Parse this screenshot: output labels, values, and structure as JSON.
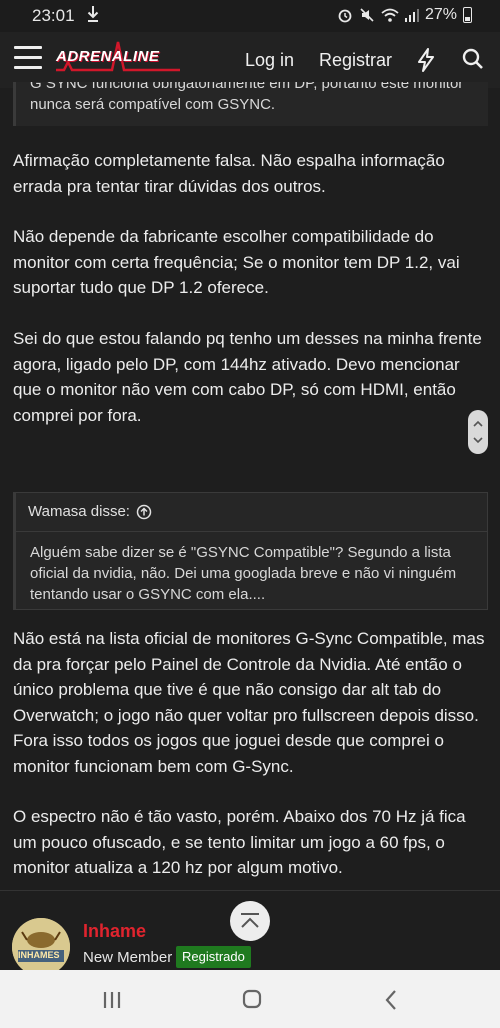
{
  "status_bar": {
    "time": "23:01",
    "battery": "27%"
  },
  "header": {
    "logo_text": "ADRENALINE",
    "login_label": "Log in",
    "register_label": "Registrar"
  },
  "post": {
    "quote_top": "G SYNC funciona obrigatoriamente em DP, portanto este monitor nunca será compatível com GSYNC.",
    "paragraphs": [
      "Afirmação completamente falsa. Não espalha informação errada pra tentar tirar dúvidas dos outros.",
      "Não depende da fabricante escolher compatibilidade do monitor com certa frequência; Se o monitor tem DP 1.2, vai suportar tudo que DP 1.2 oferece.",
      "Sei do que estou falando pq tenho um desses na minha frente agora, ligado pelo DP, com 144hz ativado. Devo mencionar que o monitor não vem com cabo DP, só com HDMI, então comprei por fora."
    ],
    "quote2": {
      "attribution": "Wamasa disse:",
      "body": "Alguém sabe dizer se é \"GSYNC Compatible\"? Segundo a lista oficial da nvidia, não. Dei uma googlada breve e não vi ninguém tentando usar o GSYNC com ela...."
    },
    "paragraphs2": [
      "Não está na lista oficial de monitores G-Sync Compatible, mas da pra forçar pelo Painel de Controle da Nvidia. Até então o único problema que tive é que não consigo dar alt tab do Overwatch; o jogo não quer voltar pro fullscreen depois disso. Fora isso todos os jogos que joguei desde que comprei o monitor funcionam bem com G-Sync.",
      "O espectro não é tão vasto, porém. Abaixo dos 70 Hz já fica um pouco ofuscado, e se tento limitar um jogo a 60 fps, o monitor atualiza a 120 hz por algum motivo."
    ]
  },
  "author": {
    "username": "Inhame",
    "title": "New Member",
    "badge": "Registrado",
    "avatar_text": "INHAMES"
  },
  "colors": {
    "accent": "#e0242e",
    "badge": "#1f7a1f",
    "background": "#1e1e1e"
  }
}
